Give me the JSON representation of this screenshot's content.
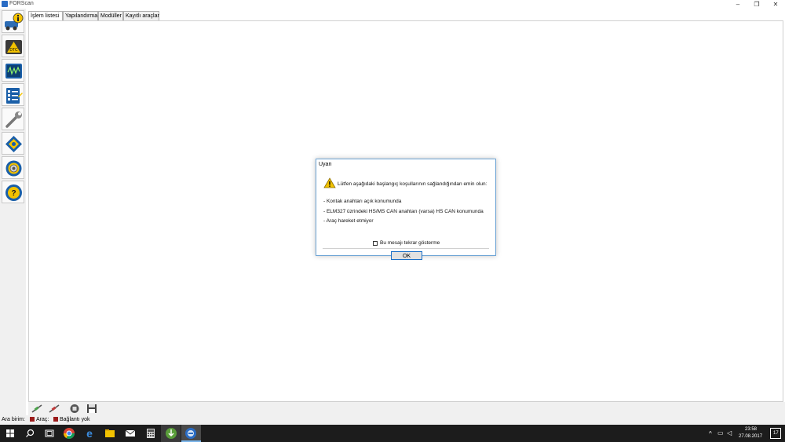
{
  "window": {
    "title": "FORScan"
  },
  "tabs": [
    "İşlem listesi",
    "Yapılandırma",
    "Modüller",
    "Kayıtlı araçlar"
  ],
  "sidebar": {
    "items": [
      {
        "icon": "vehicle-info-icon"
      },
      {
        "icon": "dtc-icon"
      },
      {
        "icon": "oscilloscope-icon"
      },
      {
        "icon": "checklist-icon"
      },
      {
        "icon": "wrench-icon"
      },
      {
        "icon": "module-config-icon"
      },
      {
        "icon": "settings-gear-icon"
      },
      {
        "icon": "help-icon"
      }
    ]
  },
  "status": {
    "interface_label": "Ara birim:",
    "vehicle_label": "Araç:",
    "connection_label": "Bağlantı yok",
    "indicator_color": "#9b1c1c"
  },
  "dialog": {
    "title": "Uyarı",
    "message": "Lütfen aşağıdaki başlangıç koşullarının sağlandığından emin olun:",
    "items": [
      "- Kontak anahtarı açık konumunda",
      "- ELM327 üzrindeki HS/MS CAN anahtarı (varsa) HS CAN konumunda",
      "- Araç hareket etmiyor"
    ],
    "checkbox_label": "Bu mesajı tekrar gösterme",
    "ok_label": "OK"
  },
  "taskbar": {
    "time": "23:58",
    "date": "27.08.2017",
    "notification_count": "17"
  }
}
